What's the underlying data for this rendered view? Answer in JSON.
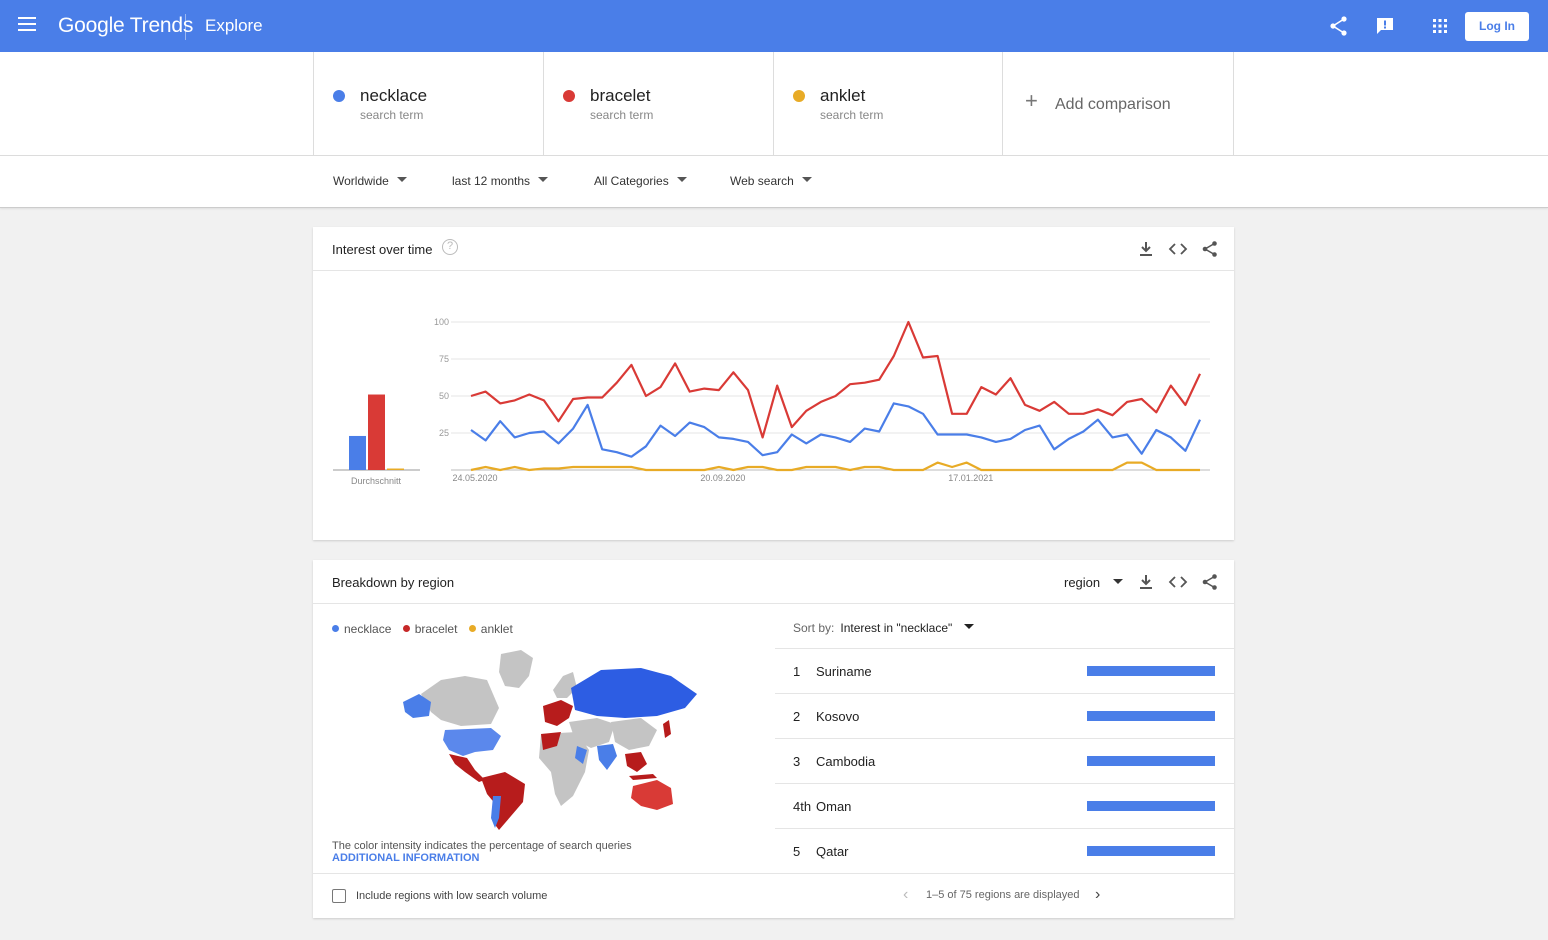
{
  "header": {
    "logo_google": "Google",
    "logo_trends": "Trends",
    "section": "Explore",
    "login_label": "Log In",
    "icons": [
      "menu-icon",
      "share-icon",
      "feedback-icon",
      "apps-icon"
    ]
  },
  "terms": [
    {
      "name": "necklace",
      "sub": "search term",
      "color": "#4a7ee8"
    },
    {
      "name": "bracelet",
      "sub": "search term",
      "color": "#d93a36"
    },
    {
      "name": "anklet",
      "sub": "search term",
      "color": "#e8ab26"
    }
  ],
  "add_comparison": "Add comparison",
  "filters": {
    "region": "Worldwide",
    "time": "last 12 months",
    "category": "All Categories",
    "type": "Web search"
  },
  "interest": {
    "title": "Interest over time",
    "help": "?",
    "avg_label": "Durchschnitt",
    "y_ticks": [
      "100",
      "75",
      "50",
      "25"
    ],
    "date_labels": [
      "24.05.2020",
      "20.09.2020",
      "17.01.2021"
    ]
  },
  "chart_data": {
    "type": "line",
    "ylim": [
      0,
      100
    ],
    "x_labels": [
      "24.05.2020",
      "20.09.2020",
      "17.01.2021"
    ],
    "averages": {
      "necklace": 23,
      "bracelet": 51,
      "anklet": 1
    },
    "series": [
      {
        "name": "necklace",
        "color": "#4a7ee8",
        "values": [
          27,
          20,
          33,
          22,
          25,
          26,
          18,
          28,
          44,
          14,
          12,
          9,
          16,
          30,
          23,
          32,
          29,
          22,
          21,
          19,
          10,
          12,
          24,
          18,
          24,
          22,
          19,
          28,
          26,
          45,
          43,
          38,
          24,
          24,
          24,
          22,
          19,
          21,
          27,
          30,
          14,
          21,
          26,
          34,
          22,
          24,
          11,
          27,
          22,
          13,
          34
        ]
      },
      {
        "name": "bracelet",
        "color": "#d93a36",
        "values": [
          50,
          53,
          45,
          47,
          51,
          47,
          33,
          48,
          49,
          49,
          59,
          71,
          50,
          56,
          72,
          53,
          55,
          54,
          66,
          54,
          22,
          57,
          29,
          40,
          46,
          50,
          58,
          59,
          61,
          77,
          100,
          76,
          77,
          38,
          38,
          56,
          51,
          62,
          44,
          40,
          46,
          38,
          38,
          41,
          37,
          46,
          48,
          39,
          57,
          44,
          65
        ]
      },
      {
        "name": "anklet",
        "color": "#e8ab26",
        "values": [
          0,
          2,
          0,
          2,
          0,
          1,
          1,
          2,
          2,
          2,
          2,
          2,
          0,
          0,
          0,
          0,
          0,
          2,
          0,
          2,
          2,
          0,
          0,
          2,
          2,
          2,
          0,
          2,
          2,
          0,
          0,
          0,
          5,
          2,
          5,
          0,
          0,
          0,
          0,
          0,
          0,
          0,
          0,
          0,
          0,
          5,
          5,
          0,
          0,
          0,
          0
        ]
      }
    ]
  },
  "region": {
    "title": "Breakdown by region",
    "resolution": "region",
    "legend": [
      "necklace",
      "bracelet",
      "anklet"
    ],
    "note": "The color intensity indicates the percentage of search queries",
    "more_info": "ADDITIONAL INFORMATION",
    "sort_label": "Sort by:",
    "sort_value": "Interest in \"necklace\"",
    "rows": [
      {
        "rank": "1",
        "name": "Suriname",
        "value": 100
      },
      {
        "rank": "2",
        "name": "Kosovo",
        "value": 100
      },
      {
        "rank": "3",
        "name": "Cambodia",
        "value": 100
      },
      {
        "rank": "4th",
        "name": "Oman",
        "value": 100
      },
      {
        "rank": "5",
        "name": "Qatar",
        "value": 100
      }
    ],
    "low_volume_label": "Include regions with low search volume",
    "pager_text": "1–5 of 75 regions are displayed"
  }
}
